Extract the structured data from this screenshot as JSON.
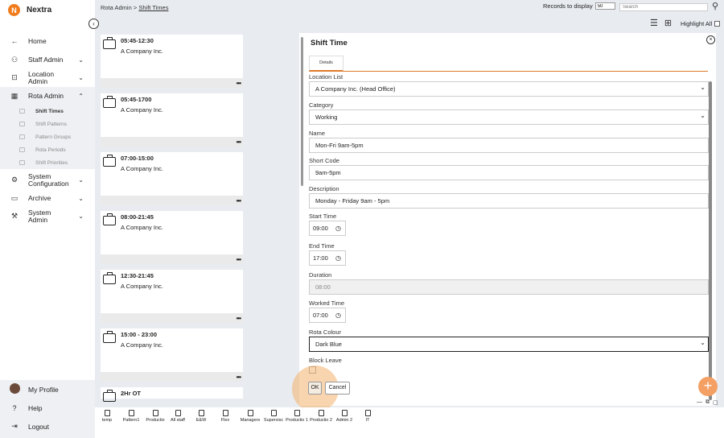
{
  "app": {
    "name": "Nextra",
    "logo_letter": "N"
  },
  "sidebar": {
    "items": [
      {
        "label": "Home",
        "icon": "←"
      },
      {
        "label": "Staff Admin",
        "icon": "⚇",
        "chevron": "⌄"
      },
      {
        "label": "Location Admin",
        "icon": "⊡",
        "chevron": "⌄"
      },
      {
        "label": "Rota Admin",
        "icon": "▦",
        "chevron": "⌃"
      }
    ],
    "sub_items": [
      "Shift Times",
      "Shift Patterns",
      "Pattern Groups",
      "Rota Periods",
      "Shift Priorities"
    ],
    "more_items": [
      {
        "label": "System Configuration",
        "icon": "⚙",
        "chevron": "⌄"
      },
      {
        "label": "Archive",
        "icon": "▭",
        "chevron": "⌄"
      },
      {
        "label": "System Admin",
        "icon": "⚒",
        "chevron": "⌄"
      }
    ],
    "footer": [
      {
        "label": "My Profile"
      },
      {
        "label": "Help",
        "icon": "?"
      },
      {
        "label": "Logout",
        "icon": "⇥"
      }
    ],
    "collapse_icon": "‹"
  },
  "header": {
    "breadcrumb_root": "Rota Admin",
    "breadcrumb_sep": ">",
    "breadcrumb_current": "Shift Times",
    "records_label": "Records to display",
    "records_value": "50",
    "search_placeholder": "Search",
    "highlight_label": "Highlight All"
  },
  "cards": [
    {
      "time": "05:45-12:30",
      "company": "A Company Inc."
    },
    {
      "time": "05:45-1700",
      "company": "A Company Inc."
    },
    {
      "time": "07:00-15:00",
      "company": "A Company Inc."
    },
    {
      "time": "08:00-21:45",
      "company": "A Company Inc."
    },
    {
      "time": "12:30-21:45",
      "company": "A Company Inc."
    },
    {
      "time": "15:00 - 23:00",
      "company": "A Company Inc."
    },
    {
      "time": "2Hr OT",
      "company": ""
    }
  ],
  "card_menu": "•••",
  "panel": {
    "title": "Shift Time",
    "close": "×",
    "tab": "Details",
    "fields": {
      "location_label": "Location List",
      "location_value": "A Company Inc. (Head Office)",
      "category_label": "Category",
      "category_value": "Working",
      "name_label": "Name",
      "name_value": "Mon-Fri 9am-5pm",
      "short_label": "Short Code",
      "short_value": "9am-5pm",
      "desc_label": "Description",
      "desc_value": "Monday - Friday 9am - 5pm",
      "start_label": "Start Time",
      "start_value": "09:00",
      "end_label": "End Time",
      "end_value": "17:00",
      "duration_label": "Duration",
      "duration_value": "08:00",
      "worked_label": "Worked Time",
      "worked_value": "07:00",
      "colour_label": "Rota Colour",
      "colour_value": "Dark Blue",
      "block_label": "Block Leave"
    },
    "ok": "OK",
    "cancel": "Cancel"
  },
  "fab": "+",
  "bottom_bar": [
    "temp",
    "Pattern1",
    "Productio",
    "All staff",
    "E&W",
    "Flex",
    "Managers",
    "Supervisc",
    "Productio 1",
    "Productio 2",
    "Admin 2",
    "IT"
  ],
  "colors": {
    "accent": "#e07a2a",
    "sidebar_active": "#eef0f3",
    "main_bg": "#e8ebf0"
  }
}
